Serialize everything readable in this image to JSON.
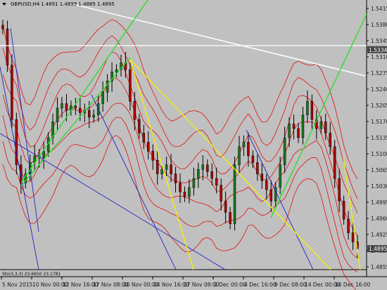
{
  "header": {
    "symbol": "GBPUSD,H4",
    "quote": "1.4891 1.4899 1.4885 1.4895"
  },
  "indicator_label": "Sto(3,3,3) 23.6650 23.1781",
  "colors": {
    "background": "#c0c0c0",
    "bull_candle": "#1a7a1a",
    "bear_candle": "#b00000",
    "band": "#e01010",
    "channel": "#2323c8",
    "trend_yellow": "#f2f200",
    "trend_green": "#22e022",
    "resistance_white": "#ffffff",
    "current_price_tag": "#444444"
  },
  "chart_data": {
    "type": "candlestick",
    "symbol": "GBPUSD",
    "timeframe": "H4",
    "ylim": [
      1.4855,
      1.5425
    ],
    "y_ticks": [
      "1.5415",
      "1.5380",
      "1.5345",
      "1.5310",
      "1.5275",
      "1.5240",
      "1.5205",
      "1.5170",
      "1.5135",
      "1.5100",
      "1.5065",
      "1.5030",
      "1.4995",
      "1.4960",
      "1.4925",
      "1.4890",
      "1.4855"
    ],
    "x_ticks": [
      "5 Nov 2015",
      "10 Nov 00:00",
      "12 Nov 16:00",
      "17 Nov 08:00",
      "20 Nov 00:00",
      "24 Nov 16:00",
      "27 Nov 08:00",
      "2 Dec 00:00",
      "4 Dec 16:00",
      "9 Dec 08:00",
      "14 Dec 00:00",
      "16 Dec 16:00"
    ],
    "price_levels": [
      {
        "label": "1.5334",
        "value": 1.5334
      },
      {
        "label": "1.4895",
        "value": 1.4895
      }
    ],
    "closes": [
      1.538,
      1.53,
      1.518,
      1.508,
      1.504,
      1.506,
      1.5085,
      1.51,
      1.5095,
      1.511,
      1.514,
      1.5175,
      1.5205,
      1.5215,
      1.52,
      1.521,
      1.5205,
      1.5195,
      1.52,
      1.5185,
      1.519,
      1.5215,
      1.524,
      1.5265,
      1.5285,
      1.529,
      1.5305,
      1.529,
      1.522,
      1.518,
      1.515,
      1.513,
      1.511,
      1.509,
      1.506,
      1.507,
      1.508,
      1.506,
      1.504,
      1.502,
      1.501,
      1.503,
      1.505,
      1.507,
      1.508,
      1.5065,
      1.505,
      1.5035,
      1.5,
      1.4975,
      1.495,
      1.508,
      1.512,
      1.513,
      1.51,
      1.5085,
      1.506,
      1.5045,
      1.5025,
      1.5,
      1.503,
      1.508,
      1.514,
      1.517,
      1.516,
      1.514,
      1.519,
      1.522,
      1.518,
      1.516,
      1.5175,
      1.515,
      1.512,
      1.505,
      1.5,
      1.496,
      1.493,
      1.491,
      1.4895
    ],
    "lines": [
      {
        "name": "resistance",
        "color": "white"
      },
      {
        "name": "level",
        "color": "white"
      },
      {
        "name": "channel",
        "color": "blue"
      },
      {
        "name": "trend",
        "color": "yellow"
      },
      {
        "name": "trend",
        "color": "green"
      }
    ]
  }
}
